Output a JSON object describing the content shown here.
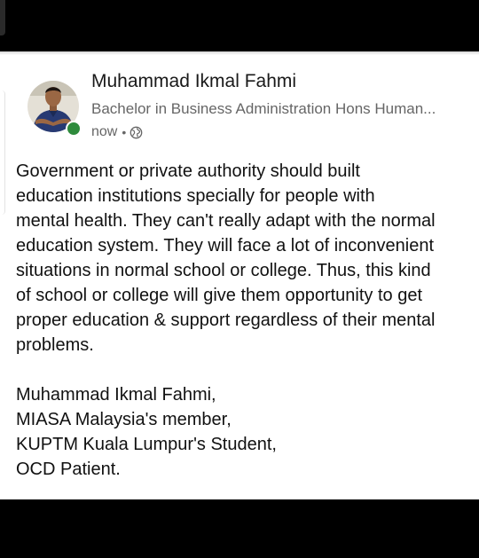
{
  "post": {
    "author": {
      "name": "Muhammad Ikmal Fahmi",
      "headline": "Bachelor in Business Administration Hons Human...",
      "online": true
    },
    "meta": {
      "time": "now",
      "separator": "•",
      "visibility_icon": "globe-icon"
    },
    "body_lines": [
      "Government or private authority  should built",
      "education institutions specially for people with",
      "mental health. They can't really adapt with the normal",
      "education system. They will face a lot of inconvenient",
      "situations in normal school or college. Thus, this kind",
      "of school or college  will give them opportunity to get",
      "proper education & support regardless of their mental",
      "problems."
    ],
    "signature_lines": [
      "Muhammad Ikmal Fahmi,",
      "MIASA Malaysia's member,",
      "KUPTM Kuala Lumpur's Student,",
      "OCD Patient."
    ]
  },
  "colors": {
    "background": "#000000",
    "card": "#ffffff",
    "name_text": "#191919",
    "secondary_text": "#666666",
    "presence": "#2e8b3c"
  }
}
